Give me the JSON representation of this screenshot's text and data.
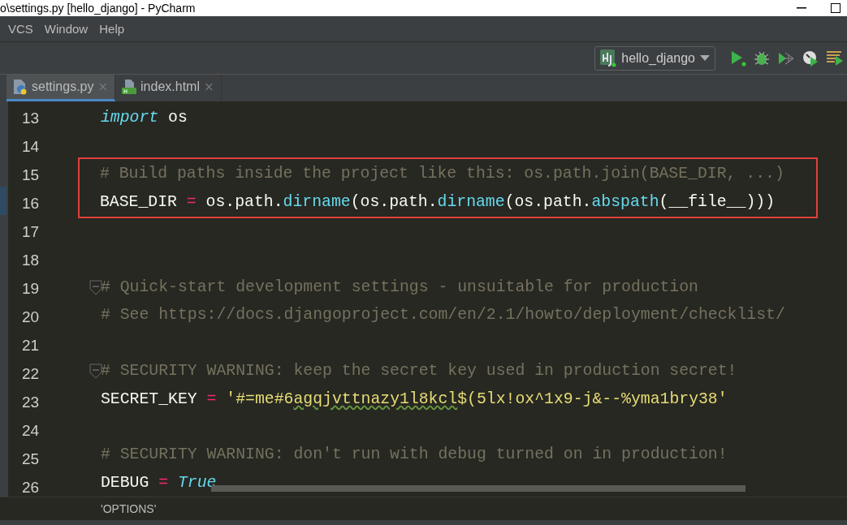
{
  "window": {
    "title": "o\\settings.py [hello_django] - PyCharm"
  },
  "menu": [
    {
      "label": "VCS"
    },
    {
      "label": "Window"
    },
    {
      "label": "Help"
    }
  ],
  "run_config": {
    "label": "hello_django"
  },
  "tabs": [
    {
      "label": "settings.py",
      "kind": "python",
      "close": "×",
      "selected": true
    },
    {
      "label": "index.html",
      "kind": "html",
      "close": "×",
      "selected": false
    }
  ],
  "editor": {
    "lines": [
      {
        "number": "13",
        "highlighted": false,
        "fold": false,
        "tokens": [
          {
            "kind": "keyword",
            "text": "import"
          },
          {
            "kind": "plain",
            "text": " os"
          }
        ]
      },
      {
        "number": "14",
        "highlighted": false,
        "fold": false
      },
      {
        "number": "15",
        "highlighted": true,
        "fold": false,
        "tokens": [
          {
            "kind": "comment",
            "text": "# Build paths inside the project like this: os.path.join(BASE_DIR, ...)"
          }
        ]
      },
      {
        "number": "16",
        "highlighted": true,
        "fold": false,
        "tokens": [
          {
            "kind": "plain",
            "text": "BASE_DIR "
          },
          {
            "kind": "op",
            "text": "="
          },
          {
            "kind": "plain",
            "text": " os.path."
          },
          {
            "kind": "func",
            "text": "dirname"
          },
          {
            "kind": "plain",
            "text": "(os.path."
          },
          {
            "kind": "func",
            "text": "dirname"
          },
          {
            "kind": "plain",
            "text": "(os.path."
          },
          {
            "kind": "func",
            "text": "abspath"
          },
          {
            "kind": "plain",
            "text": "(__file__)))"
          }
        ]
      },
      {
        "number": "17",
        "highlighted": false,
        "fold": false
      },
      {
        "number": "18",
        "highlighted": false,
        "fold": false
      },
      {
        "number": "19",
        "highlighted": false,
        "fold": true,
        "tokens": [
          {
            "kind": "comment",
            "text": "# Quick-start development settings - unsuitable for production"
          }
        ]
      },
      {
        "number": "20",
        "highlighted": false,
        "fold": false,
        "tokens": [
          {
            "kind": "comment",
            "text": "# See https://docs.djangoproject.com/en/2.1/howto/deployment/checklist/"
          }
        ]
      },
      {
        "number": "21",
        "highlighted": false,
        "fold": false
      },
      {
        "number": "22",
        "highlighted": false,
        "fold": true,
        "tokens": [
          {
            "kind": "comment",
            "text": "# SECURITY WARNING: keep the secret key used in production secret!"
          }
        ]
      },
      {
        "number": "23",
        "highlighted": false,
        "fold": false,
        "tokens": [
          {
            "kind": "plain",
            "text": "SECRET_KEY "
          },
          {
            "kind": "op",
            "text": "="
          },
          {
            "kind": "string",
            "text": " '#=me#6"
          },
          {
            "kind": "typo",
            "text": "agqjvttnazy1l8kcl"
          },
          {
            "kind": "string",
            "text": "$(5lx!ox^1x9-j&--%yma1bry38'"
          }
        ]
      },
      {
        "number": "24",
        "highlighted": false,
        "fold": false
      },
      {
        "number": "25",
        "highlighted": false,
        "fold": false,
        "tokens": [
          {
            "kind": "comment",
            "text": "# SECURITY WARNING: don't run with debug turned on in production!"
          }
        ]
      },
      {
        "number": "26",
        "highlighted": false,
        "fold": false,
        "tokens": [
          {
            "kind": "plain",
            "text": "DEBUG "
          },
          {
            "kind": "op",
            "text": "="
          },
          {
            "kind": "constant",
            "text": " True"
          }
        ]
      }
    ]
  },
  "breadcrumb": "'OPTIONS'"
}
